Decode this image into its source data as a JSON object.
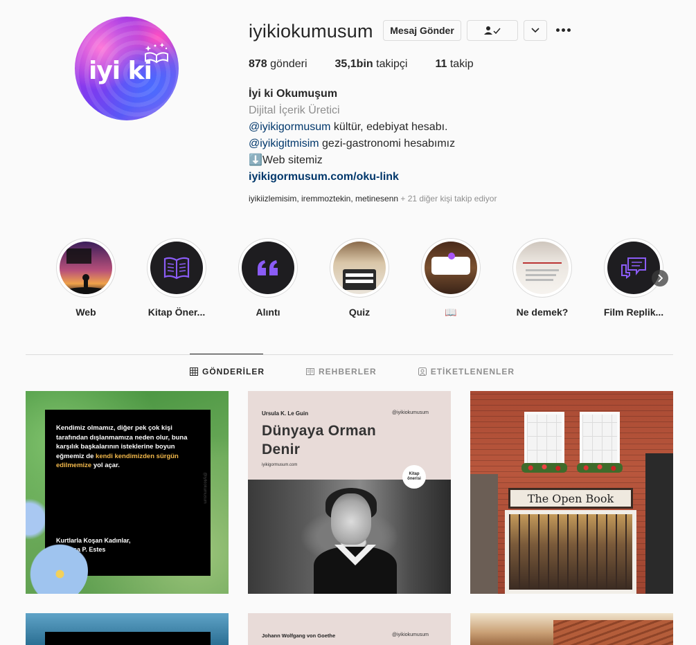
{
  "profile": {
    "username": "iyikiokumusum",
    "avatar_text": "iyi ki",
    "buttons": {
      "message": "Mesaj Gönder",
      "follow_icon": "person-check-icon",
      "dropdown_icon": "chevron-down-icon",
      "more_icon": "more-options-icon"
    },
    "stats": [
      {
        "value": "878",
        "label": "gönderi"
      },
      {
        "value": "35,1bin",
        "label": "takipçi"
      },
      {
        "value": "11",
        "label": "takip"
      }
    ],
    "bio": {
      "name": "İyi ki Okumuşum",
      "category": "Dijital İçerik Üretici",
      "line1_mention": "@iyikigormusum",
      "line1_text": " kültür, edebiyat hesabı.",
      "line2_mention": "@iyikigitmisim",
      "line2_text": " gezi-gastronomi hesabımız",
      "line3": "⬇️Web sitemiz",
      "link": "iyikigormusum.com/oku-link"
    },
    "followed_by": {
      "names": "iyikiizlemisim, iremmoztekin, metinesenn",
      "more": " + 21 diğer kişi takip ediyor"
    }
  },
  "highlights": [
    {
      "label": "Web",
      "icon": "little-prince-image"
    },
    {
      "label": "Kitap Öner...",
      "icon": "open-book-icon"
    },
    {
      "label": "Alıntı",
      "icon": "quote-icon"
    },
    {
      "label": "Quiz",
      "icon": "quiz-image"
    },
    {
      "label": "📖",
      "icon": "question-sticker-image"
    },
    {
      "label": "Ne demek?",
      "icon": "musel-sel-image"
    },
    {
      "label": "Film Replik...",
      "icon": "speech-bubble-icon"
    }
  ],
  "tabs": [
    {
      "label": "GÖNDERİLER",
      "icon": "grid-icon",
      "active": true
    },
    {
      "label": "REHBERLER",
      "icon": "guide-icon",
      "active": false
    },
    {
      "label": "ETİKETLENENLER",
      "icon": "tagged-icon",
      "active": false
    }
  ],
  "posts": {
    "p1": {
      "quote_a": "Kendimiz olmamız, diğer pek çok kişi tarafından dışlanmamıza neden olur, buna karşılık başkalarının isteklerine boyun eğmemiz de ",
      "quote_hl": "kendi kendimizden sürgün edilmemize",
      "quote_b": " yol açar.",
      "source_line1": "Kurtlarla Koşan Kadınlar,",
      "source_line2": "Clarissa P. Estes",
      "vertical": "@iyikiokumusum"
    },
    "p2": {
      "author": "Ursula K. Le Guin",
      "handle": "@iyikiokumusum",
      "title_line1": "Dünyaya Orman",
      "title_line2": "Denir",
      "site": "iyikigormusum.com",
      "badge_line1": "Kitap",
      "badge_line2": "önerisi"
    },
    "p3": {
      "sign": "The Open Book"
    },
    "p5": {
      "author": "Johann Wolfgang von Goethe",
      "handle": "@iyikiokumusum"
    }
  },
  "colors": {
    "accent_link": "#00376b",
    "text": "#262626",
    "muted": "#8e8e8e",
    "quote_highlight": "#f2b84b"
  }
}
